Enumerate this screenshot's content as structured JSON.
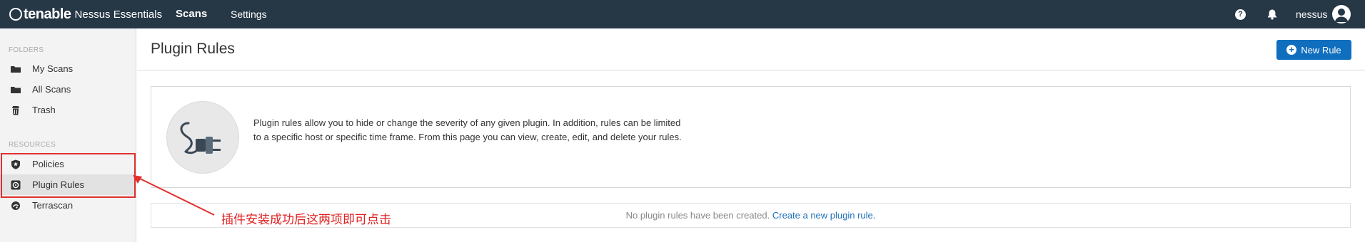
{
  "topbar": {
    "brand": "tenable",
    "product": "Nessus Essentials",
    "nav": [
      {
        "label": "Scans"
      },
      {
        "label": "Settings"
      }
    ],
    "help_glyph": "?",
    "username": "nessus"
  },
  "sidebar": {
    "folders_heading": "FOLDERS",
    "resources_heading": "RESOURCES",
    "folders": [
      {
        "label": "My Scans",
        "icon": "folder-icon"
      },
      {
        "label": "All Scans",
        "icon": "folder-icon"
      },
      {
        "label": "Trash",
        "icon": "trash-icon"
      }
    ],
    "resources": [
      {
        "label": "Policies",
        "icon": "shield-icon"
      },
      {
        "label": "Plugin Rules",
        "icon": "plugin-rules-icon",
        "active": true
      },
      {
        "label": "Terrascan",
        "icon": "terrascan-icon"
      }
    ]
  },
  "main": {
    "title": "Plugin Rules",
    "new_rule_label": "New Rule",
    "plus_glyph": "+",
    "info_text": "Plugin rules allow you to hide or change the severity of any given plugin. In addition, rules can be limited to a specific host or specific time frame. From this page you can view, create, edit, and delete your rules.",
    "empty_text": "No plugin rules have been created.",
    "empty_link": "Create a new plugin rule."
  },
  "annotation": {
    "text": "插件安装成功后这两项即可点击"
  },
  "colors": {
    "topbar": "#263746",
    "accent": "#0f6ebd",
    "annotation": "#e03030"
  }
}
